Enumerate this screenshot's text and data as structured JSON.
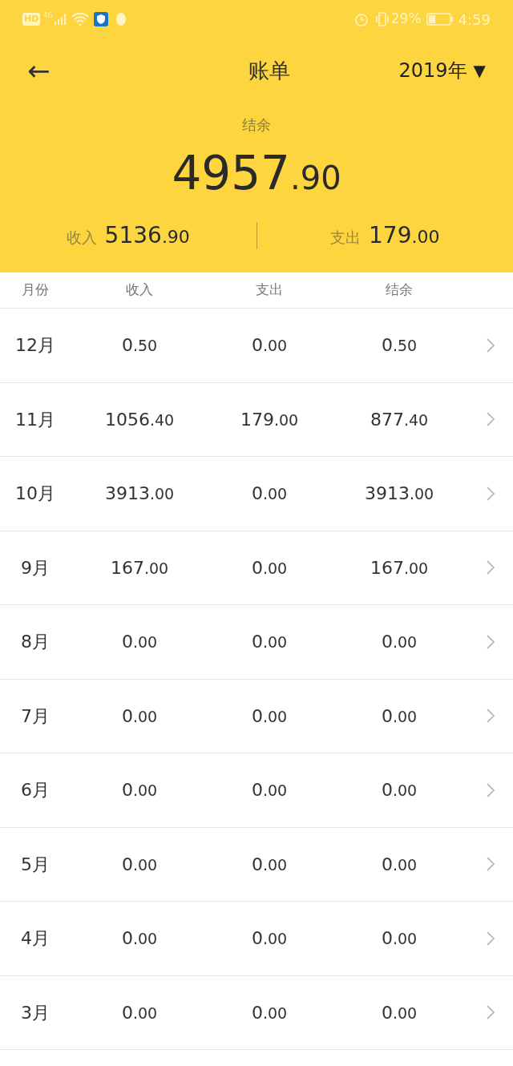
{
  "status_bar": {
    "network_badge": "HD",
    "network_type": "4G",
    "battery_percent": "29%",
    "time": "4:59"
  },
  "header": {
    "back": "←",
    "title": "账单",
    "year": "2019年",
    "year_caret": "▼"
  },
  "balance": {
    "label": "结余",
    "int": "4957",
    "dec": ".90"
  },
  "summary": [
    {
      "label": "收入",
      "int": "5136",
      "dec": ".90"
    },
    {
      "label": "支出",
      "int": "179",
      "dec": ".00"
    }
  ],
  "table": {
    "columns": [
      "月份",
      "收入",
      "支出",
      "结余"
    ],
    "rows": [
      {
        "month": "12月",
        "income": [
          "0",
          ".50"
        ],
        "expense": [
          "0",
          ".00"
        ],
        "balance": [
          "0",
          ".50"
        ]
      },
      {
        "month": "11月",
        "income": [
          "1056",
          ".40"
        ],
        "expense": [
          "179",
          ".00"
        ],
        "balance": [
          "877",
          ".40"
        ]
      },
      {
        "month": "10月",
        "income": [
          "3913",
          ".00"
        ],
        "expense": [
          "0",
          ".00"
        ],
        "balance": [
          "3913",
          ".00"
        ]
      },
      {
        "month": "9月",
        "income": [
          "167",
          ".00"
        ],
        "expense": [
          "0",
          ".00"
        ],
        "balance": [
          "167",
          ".00"
        ]
      },
      {
        "month": "8月",
        "income": [
          "0",
          ".00"
        ],
        "expense": [
          "0",
          ".00"
        ],
        "balance": [
          "0",
          ".00"
        ]
      },
      {
        "month": "7月",
        "income": [
          "0",
          ".00"
        ],
        "expense": [
          "0",
          ".00"
        ],
        "balance": [
          "0",
          ".00"
        ]
      },
      {
        "month": "6月",
        "income": [
          "0",
          ".00"
        ],
        "expense": [
          "0",
          ".00"
        ],
        "balance": [
          "0",
          ".00"
        ]
      },
      {
        "month": "5月",
        "income": [
          "0",
          ".00"
        ],
        "expense": [
          "0",
          ".00"
        ],
        "balance": [
          "0",
          ".00"
        ]
      },
      {
        "month": "4月",
        "income": [
          "0",
          ".00"
        ],
        "expense": [
          "0",
          ".00"
        ],
        "balance": [
          "0",
          ".00"
        ]
      },
      {
        "month": "3月",
        "income": [
          "0",
          ".00"
        ],
        "expense": [
          "0",
          ".00"
        ],
        "balance": [
          "0",
          ".00"
        ]
      }
    ]
  }
}
